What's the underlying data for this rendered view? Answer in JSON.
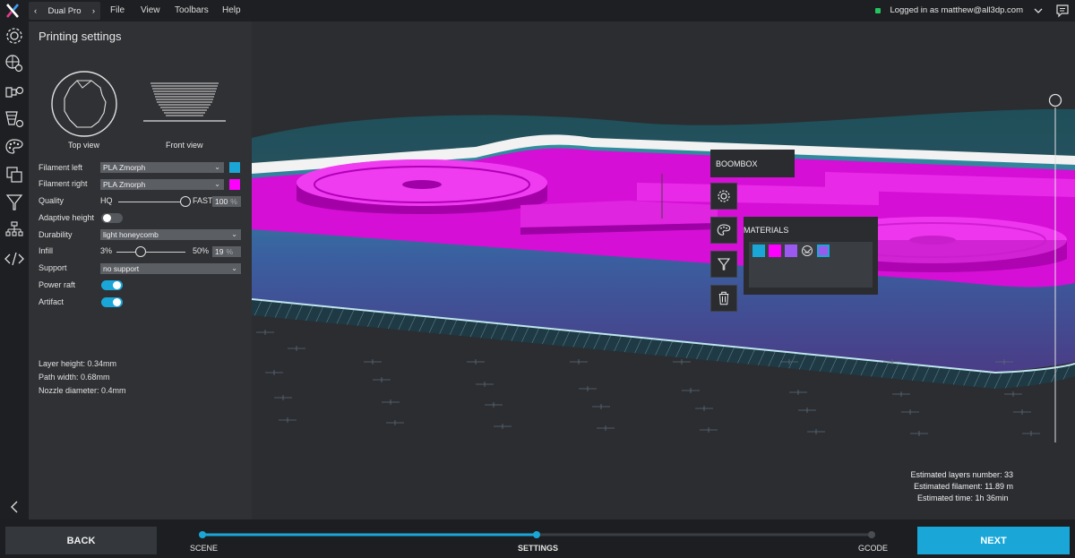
{
  "topbar": {
    "device": "Dual Pro",
    "menu": [
      "File",
      "View",
      "Toolbars",
      "Help"
    ],
    "login_text": "Logged in as matthew@all3dp.com"
  },
  "toolbar": {
    "icons": [
      "gear-icon",
      "globe-gear-icon",
      "hand-gear-icon",
      "layers-gear-icon",
      "palette-icon",
      "copy-icon",
      "filter-icon",
      "hierarchy-icon",
      "code-icon",
      "collapse-icon"
    ]
  },
  "panel": {
    "title": "Printing settings",
    "top_view": "Top view",
    "front_view": "Front view",
    "filament_left_label": "Filament left",
    "filament_left_value": "PLA Zmorph",
    "filament_left_color": "#1aa7d8",
    "filament_right_label": "Filament right",
    "filament_right_value": "PLA Zmorph",
    "filament_right_color": "#ff00ff",
    "quality_label": "Quality",
    "quality_min": "HQ",
    "quality_max": "FAST",
    "quality_value": "100",
    "pct": "%",
    "adaptive_height_label": "Adaptive height",
    "adaptive_height_on": false,
    "durability_label": "Durability",
    "durability_value": "light honeycomb",
    "infill_label": "Infill",
    "infill_min": "3%",
    "infill_max": "50%",
    "infill_value": "19",
    "support_label": "Support",
    "support_value": "no support",
    "power_raft_label": "Power raft",
    "power_raft_on": true,
    "artifact_label": "Artifact",
    "artifact_on": true,
    "layer_height": "Layer height: 0.34mm",
    "path_width": "Path width: 0.68mm",
    "nozzle_diameter": "Nozzle diameter: 0.4mm"
  },
  "popup": {
    "object_name": "BOOMBOX",
    "materials_title": "MATERIALS",
    "material_colors": [
      "#1aa7d8",
      "#ff00ff",
      "#9b59f0",
      "pattern",
      "#1aa7d8-#9b59f0"
    ]
  },
  "stats": {
    "layers": "Estimated layers number: 33",
    "filament": "Estimated filament: 11.89 m",
    "time": "Estimated time: 1h 36min"
  },
  "bottom": {
    "back": "BACK",
    "next": "NEXT",
    "steps": [
      "SCENE",
      "SETTINGS",
      "GCODE"
    ],
    "current_step": "SETTINGS",
    "accent": "#1aa7d8"
  }
}
